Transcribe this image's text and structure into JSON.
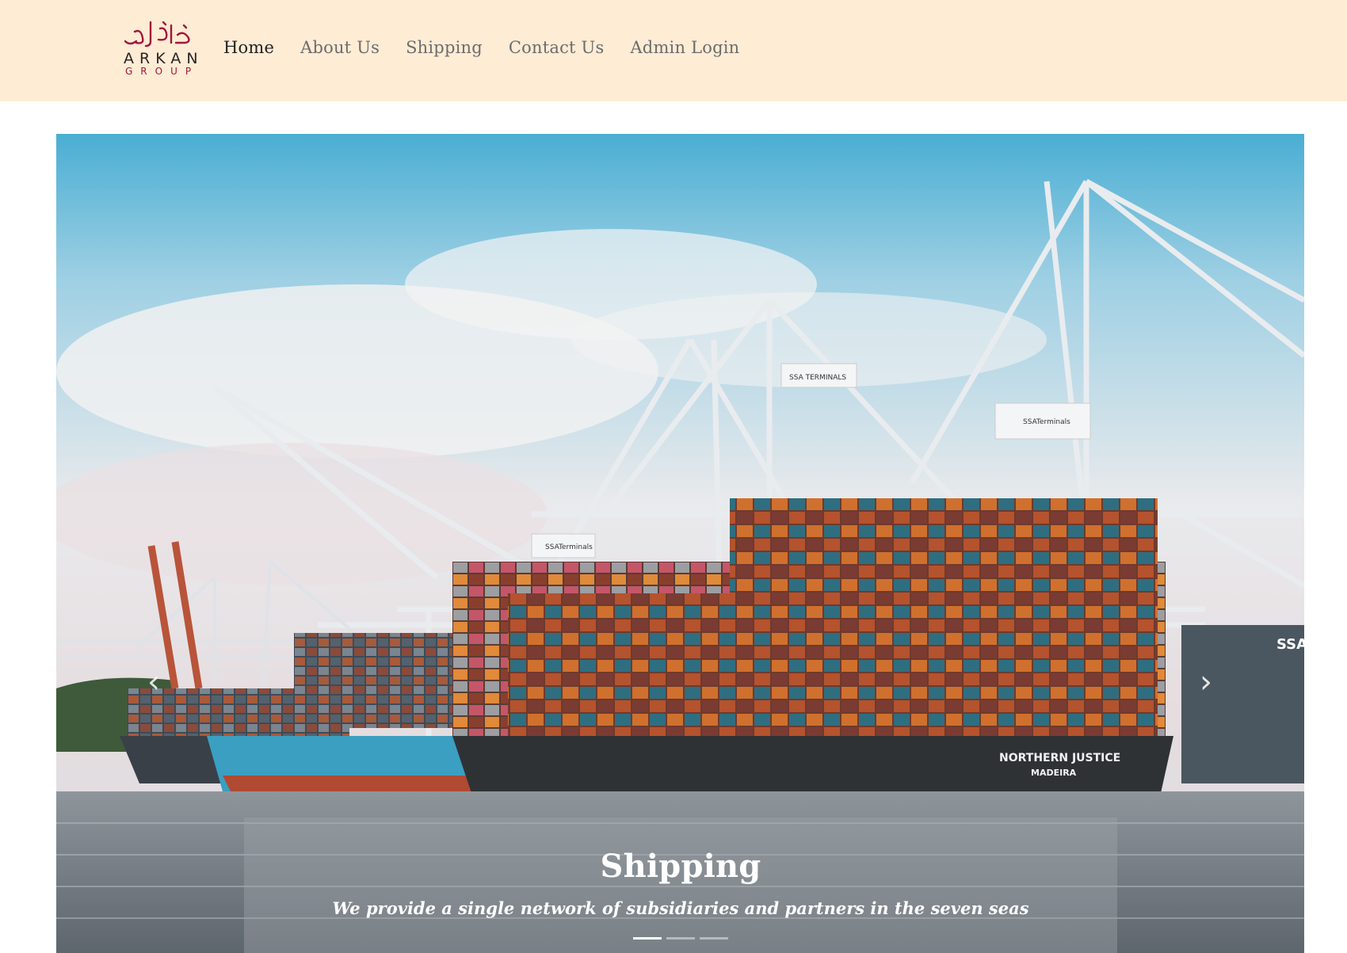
{
  "logo": {
    "arabic": "اركان",
    "line1": "ARKAN",
    "line2": "GROUP"
  },
  "nav": {
    "items": [
      {
        "label": "Home",
        "active": true
      },
      {
        "label": "About Us"
      },
      {
        "label": "Shipping"
      },
      {
        "label": "Contact Us"
      },
      {
        "label": "Admin Login"
      }
    ]
  },
  "hero": {
    "title": "Shipping",
    "subtitle": "We provide a single network of subsidiaries and partners in the seven seas",
    "prev_icon": "chevron-left-icon",
    "next_icon": "chevron-right-icon",
    "prev_glyph": "‹",
    "next_glyph": "›",
    "slide_count": 3,
    "active_slide": 1,
    "scene_labels": {
      "crane": "SSA TERMINALS",
      "ssa": "SSATerminals",
      "hull": "NORTHERN JUSTICE",
      "port": "MADEIRA",
      "ssa_side": "SSA"
    }
  },
  "colors": {
    "header_bg": "#feecd5",
    "logo_red": "#a11638",
    "nav_text": "#6c6c6c",
    "nav_active": "#222222"
  }
}
